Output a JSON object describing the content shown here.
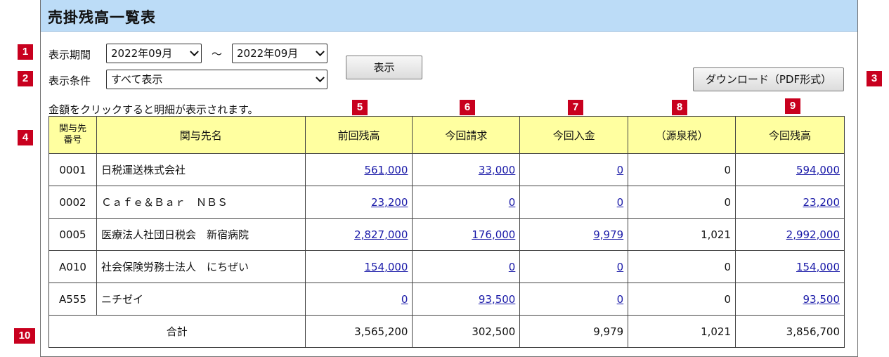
{
  "title": "売掛残高一覧表",
  "markers": [
    "1",
    "2",
    "3",
    "4",
    "5",
    "6",
    "7",
    "8",
    "9",
    "10"
  ],
  "filters": {
    "period_label": "表示期間",
    "period_from": "2022年09月",
    "tilde": "～",
    "period_to": "2022年09月",
    "condition_label": "表示条件",
    "condition_value": "すべて表示"
  },
  "buttons": {
    "show": "表示",
    "download": "ダウンロード（PDF形式）"
  },
  "hint": "金額をクリックすると明細が表示されます。",
  "table": {
    "headers": {
      "code_line1": "関与先",
      "code_line2": "番号",
      "name": "関与先名",
      "prev_balance": "前回残高",
      "billing": "今回請求",
      "receipt": "今回入金",
      "withholding": "（源泉税）",
      "balance": "今回残高"
    },
    "rows": [
      {
        "code": "0001",
        "name": "日税運送株式会社",
        "prev": "561,000",
        "billing": "33,000",
        "receipt": "0",
        "withholding": "0",
        "balance": "594,000"
      },
      {
        "code": "0002",
        "name": "Ｃａｆｅ＆Ｂａｒ　ＮＢＳ",
        "prev": "23,200",
        "billing": "0",
        "receipt": "0",
        "withholding": "0",
        "balance": "23,200"
      },
      {
        "code": "0005",
        "name": "医療法人社団日税会　新宿病院",
        "prev": "2,827,000",
        "billing": "176,000",
        "receipt": "9,979",
        "withholding": "1,021",
        "balance": "2,992,000"
      },
      {
        "code": "A010",
        "name": "社会保険労務士法人　にちぜい",
        "prev": "154,000",
        "billing": "0",
        "receipt": "0",
        "withholding": "0",
        "balance": "154,000"
      },
      {
        "code": "A555",
        "name": "ニチゼイ",
        "prev": "0",
        "billing": "93,500",
        "receipt": "0",
        "withholding": "0",
        "balance": "93,500"
      }
    ],
    "total": {
      "label": "合計",
      "prev": "3,565,200",
      "billing": "302,500",
      "receipt": "9,979",
      "withholding": "1,021",
      "balance": "3,856,700"
    }
  },
  "colors": {
    "marker": "#c8001e",
    "title_bar": "#bcdcf7",
    "header_bg": "#ffffa0",
    "link": "#1a1aa8"
  }
}
